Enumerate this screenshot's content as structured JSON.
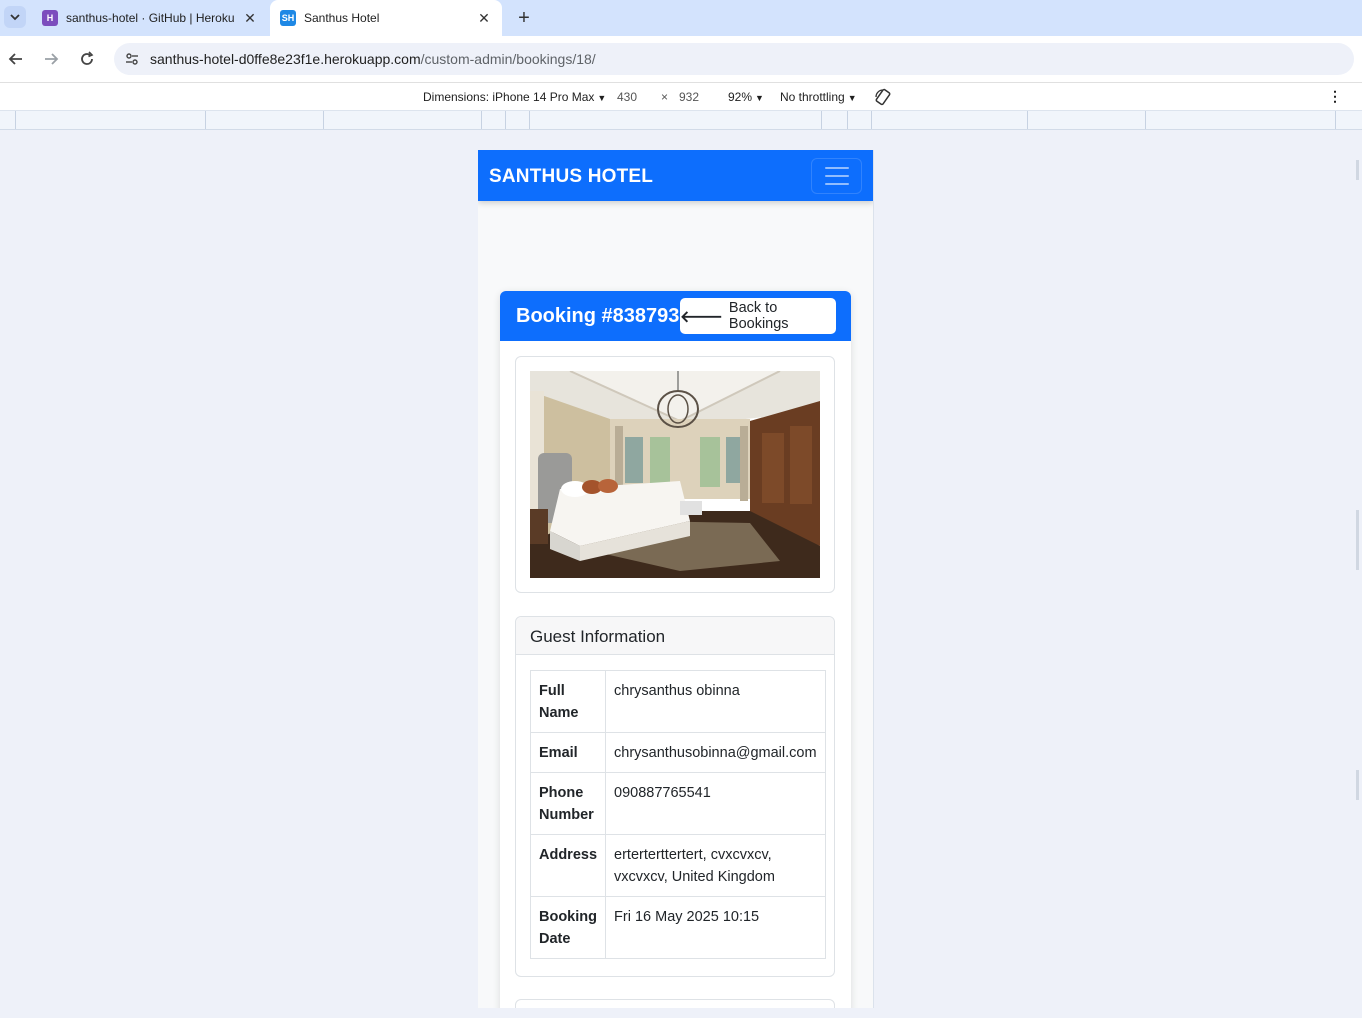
{
  "browser": {
    "tabs": [
      {
        "favicon": "H",
        "title": "santhus-hotel · GitHub | Heroku",
        "active": false
      },
      {
        "favicon": "SH",
        "title": "Santhus Hotel",
        "active": true
      }
    ],
    "url_host": "santhus-hotel-d0ffe8e23f1e.herokuapp.com",
    "url_path": "/custom-admin/bookings/18/",
    "icons": {
      "tab_list": "chevron-down-icon",
      "close": "close-icon",
      "new_tab": "plus-icon",
      "back": "arrow-left-icon",
      "forward": "arrow-right-icon",
      "reload": "reload-icon",
      "site_info": "tune-icon"
    }
  },
  "devtools": {
    "dimensions_label": "Dimensions: iPhone 14 Pro Max",
    "width": "430",
    "times": "×",
    "height": "932",
    "zoom": "92%",
    "throttling": "No throttling",
    "rotate_icon": "rotate-icon",
    "menu_icon": "kebab-icon"
  },
  "site": {
    "brand": "SANTHUS HOTEL",
    "brand_color": "#0d6efd",
    "menu_icon": "hamburger-icon"
  },
  "booking": {
    "title": "Booking #838793",
    "back_label": "Back to Bookings",
    "back_icon": "arrow-left-icon",
    "image_subject": "hotel bedroom photo",
    "guest_info": {
      "heading": "Guest Information",
      "rows": [
        {
          "label": "Full Name",
          "value": "chrysanthus obinna"
        },
        {
          "label": "Email",
          "value": "chrysanthusobinna@gmail.com"
        },
        {
          "label": "Phone Number",
          "value": "090887765541"
        },
        {
          "label": "Address",
          "value": "erterterttertert, cvxcvxcv, vxcvxcv, United Kingdom"
        },
        {
          "label": "Booking Date",
          "value": "Fri 16 May 2025 10:15"
        }
      ]
    }
  }
}
